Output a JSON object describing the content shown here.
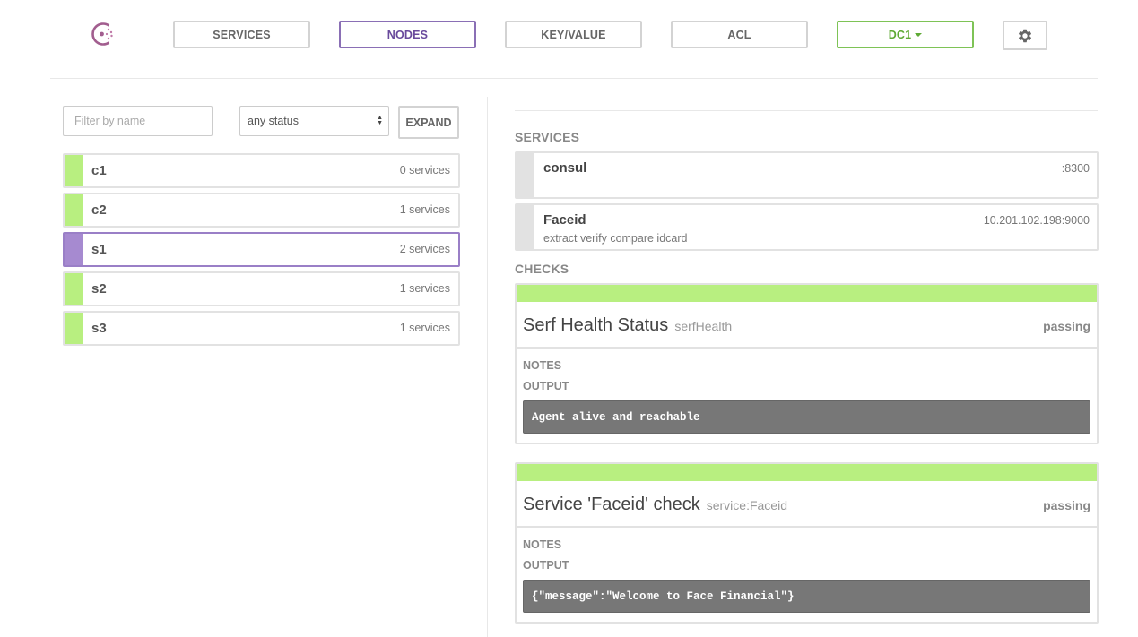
{
  "nav": {
    "services": "SERVICES",
    "nodes": "NODES",
    "keyvalue": "KEY/VALUE",
    "acl": "ACL",
    "datacenter": "DC1"
  },
  "filter": {
    "placeholder": "Filter by name",
    "status": "any status",
    "expand": "EXPAND"
  },
  "nodes": [
    {
      "name": "c1",
      "services": "0 services",
      "selected": false
    },
    {
      "name": "c2",
      "services": "1 services",
      "selected": false
    },
    {
      "name": "s1",
      "services": "2 services",
      "selected": true
    },
    {
      "name": "s2",
      "services": "1 services",
      "selected": false
    },
    {
      "name": "s3",
      "services": "1 services",
      "selected": false
    }
  ],
  "detail": {
    "services_heading": "SERVICES",
    "services": [
      {
        "name": "consul",
        "address": ":8300",
        "description": ""
      },
      {
        "name": "Faceid",
        "address": "10.201.102.198:9000",
        "description": "extract verify compare idcard"
      }
    ],
    "checks_heading": "CHECKS",
    "checks": [
      {
        "name": "Serf Health Status",
        "id": "serfHealth",
        "status": "passing",
        "notes_label": "NOTES",
        "output_label": "OUTPUT",
        "output": "Agent alive and reachable"
      },
      {
        "name": "Service 'Faceid' check",
        "id": "service:Faceid",
        "status": "passing",
        "notes_label": "NOTES",
        "output_label": "OUTPUT",
        "output": "{\"message\":\"Welcome to Face Financial\"}"
      }
    ]
  },
  "colors": {
    "passing": "#b8ef80",
    "selected": "#a68ad0",
    "accent": "#694a9c",
    "datacenter": "#5faa35"
  },
  "icons": {
    "logo": "consul-logo-icon",
    "settings": "gear-icon"
  }
}
